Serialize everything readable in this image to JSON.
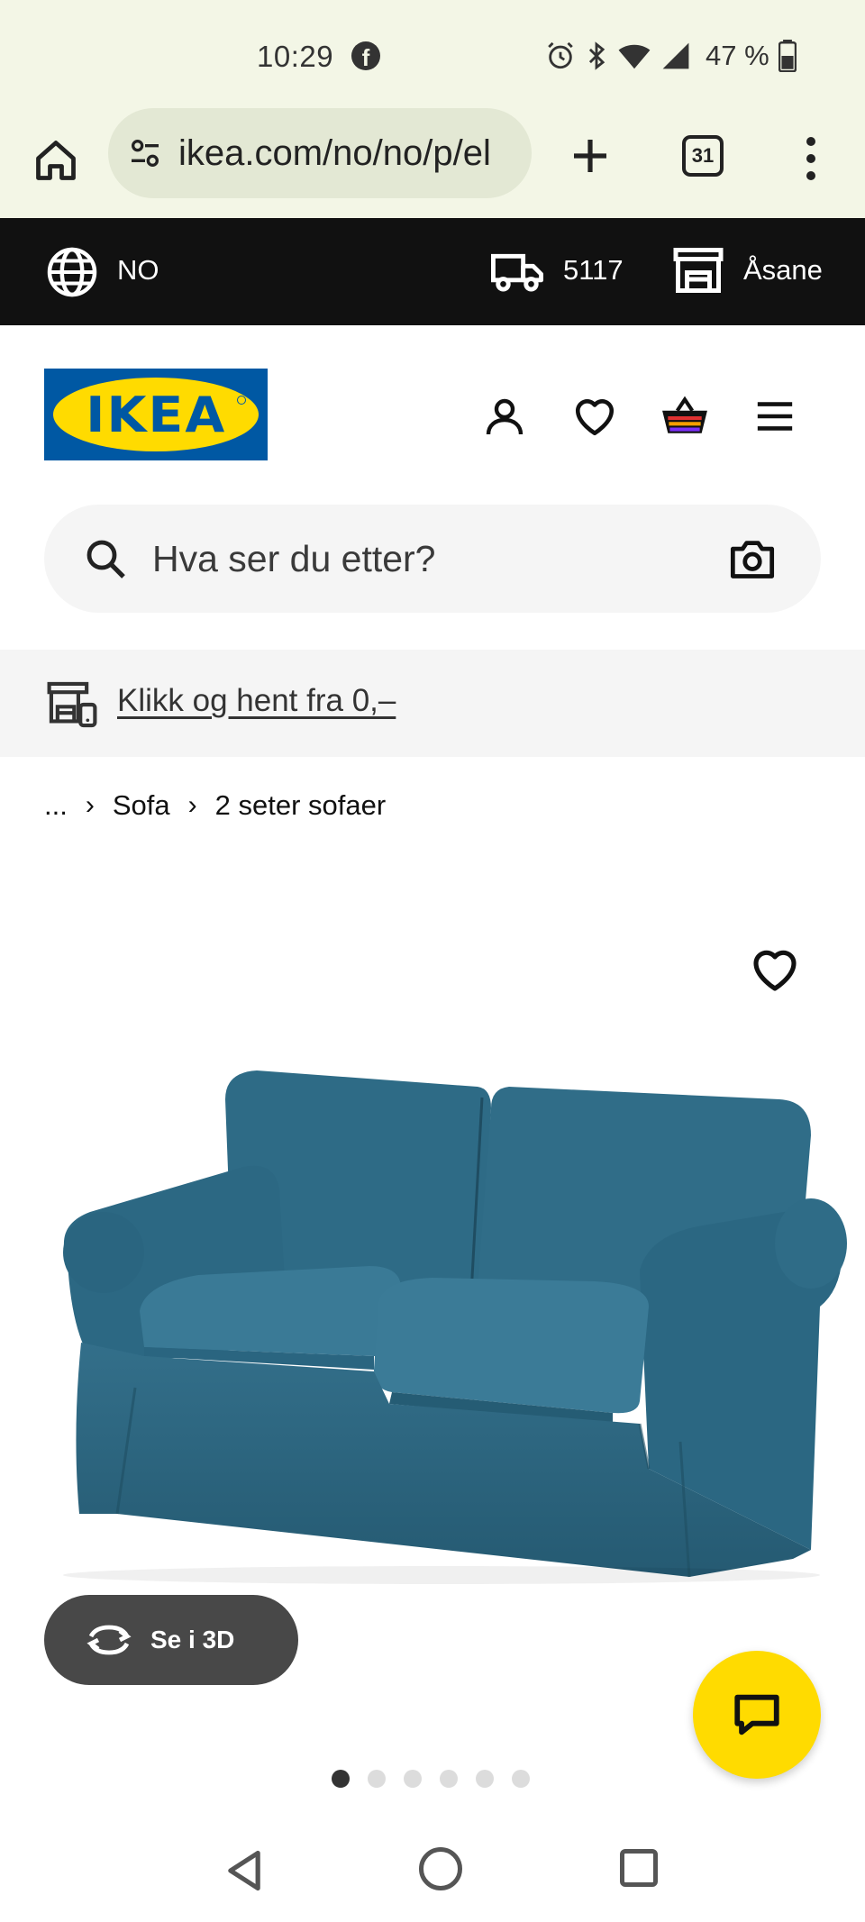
{
  "status_bar": {
    "time": "10:29",
    "battery": "47 %"
  },
  "browser": {
    "url": "ikea.com/no/no/p/el",
    "tab_count": "31"
  },
  "top_strip": {
    "country": "NO",
    "postcode": "5117",
    "store": "Åsane"
  },
  "header": {
    "logo_text": "IKEA"
  },
  "search": {
    "placeholder": "Hva ser du etter?"
  },
  "banner": {
    "click_collect": "Klikk og hent fra 0,–"
  },
  "breadcrumb": {
    "ellipsis": "...",
    "items": [
      "Sofa",
      "2 seter sofaer"
    ]
  },
  "product": {
    "view_3d_label": "Se i 3D",
    "image_count": 6,
    "active_image": 1
  },
  "colors": {
    "ikea_blue": "#0058a3",
    "ikea_yellow": "#ffdb00",
    "sofa_blue": "#2f6a84",
    "strip_black": "#111111"
  }
}
